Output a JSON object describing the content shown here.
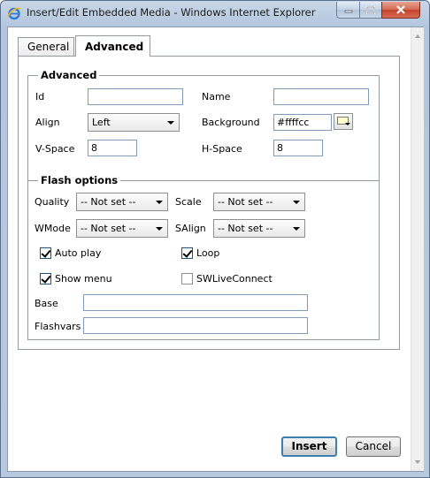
{
  "window": {
    "title": "Insert/Edit Embedded Media - Windows Internet Explorer"
  },
  "tabs": [
    {
      "label": "General",
      "selected": false
    },
    {
      "label": "Advanced",
      "selected": true
    }
  ],
  "advanced": {
    "legend": "Advanced",
    "id_label": "Id",
    "id_value": "",
    "name_label": "Name",
    "name_value": "",
    "align_label": "Align",
    "align_value": "Left",
    "background_label": "Background",
    "background_value": "#ffffcc",
    "vspace_label": "V-Space",
    "vspace_value": "8",
    "hspace_label": "H-Space",
    "hspace_value": "8"
  },
  "flash": {
    "legend": "Flash options",
    "quality_label": "Quality",
    "quality_value": "-- Not set --",
    "scale_label": "Scale",
    "scale_value": "-- Not set --",
    "wmode_label": "WMode",
    "wmode_value": "-- Not set --",
    "salign_label": "SAlign",
    "salign_value": "-- Not set --",
    "autoplay_label": "Auto play",
    "autoplay_checked": true,
    "loop_label": "Loop",
    "loop_checked": true,
    "showmenu_label": "Show menu",
    "showmenu_checked": true,
    "swlive_label": "SWLiveConnect",
    "swlive_checked": false,
    "base_label": "Base",
    "base_value": "",
    "flashvars_label": "Flashvars",
    "flashvars_value": ""
  },
  "buttons": {
    "insert": "Insert",
    "cancel": "Cancel"
  },
  "colors": {
    "background_swatch": "#ffffcc",
    "close_button": "#c4412a",
    "title_bar": "#b3c6dd"
  }
}
